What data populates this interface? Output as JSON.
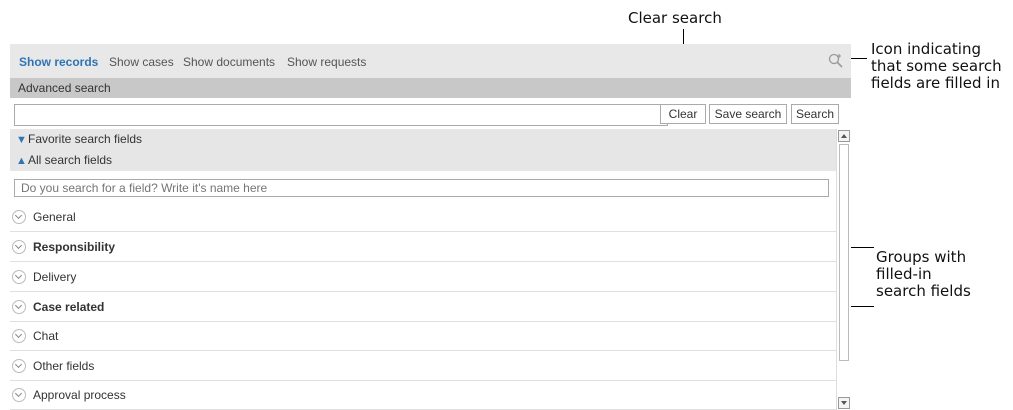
{
  "annotations": {
    "clear_search": "Clear search",
    "icon_indicator": [
      "Icon indicating",
      "that some search",
      "fields are filled in"
    ],
    "groups_filled": [
      "Groups with",
      "filled-in",
      "search fields"
    ]
  },
  "tabs": [
    "Show records",
    "Show cases",
    "Show documents",
    "Show requests"
  ],
  "active_tab": "Show records",
  "advanced_search_label": "Advanced search",
  "main_search": {
    "value": ""
  },
  "buttons": {
    "clear": "Clear",
    "save_search": "Save search",
    "search": "Search"
  },
  "favorite_fields_label": "Favorite search fields",
  "all_fields_label": "All search fields",
  "field_search_placeholder": "Do you search for a field? Write it's name here",
  "groups": [
    {
      "label": "General",
      "filled": false
    },
    {
      "label": "Responsibility",
      "filled": true
    },
    {
      "label": "Delivery",
      "filled": false
    },
    {
      "label": "Case related",
      "filled": true
    },
    {
      "label": "Chat",
      "filled": false
    },
    {
      "label": "Other fields",
      "filled": false
    },
    {
      "label": "Approval process",
      "filled": false
    }
  ],
  "colors": {
    "accent": "#2e75b6",
    "tab_bar": "#e8e8e8",
    "section_bar": "#c8c8c8"
  },
  "icons": {
    "search_indicator": "magnifier-plus-icon",
    "favorite_chevron": "chevron-down-icon",
    "all_chevron": "chevron-up-icon"
  }
}
